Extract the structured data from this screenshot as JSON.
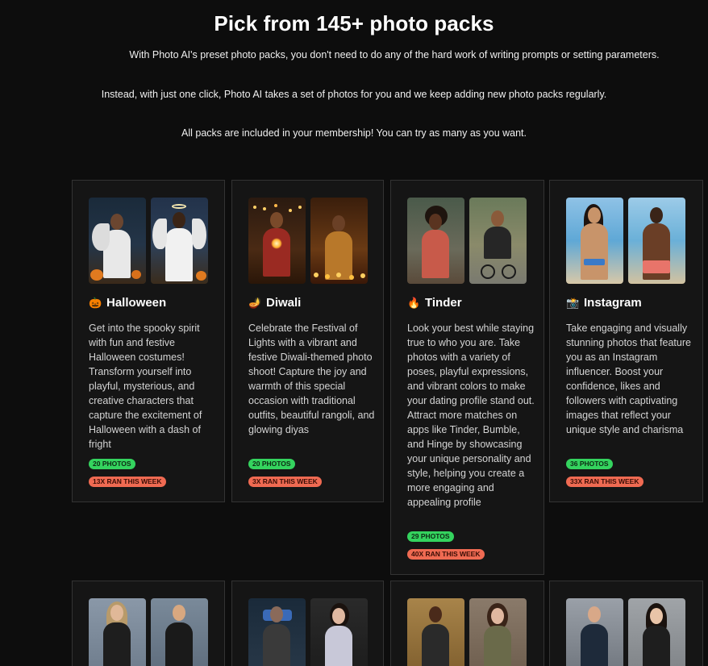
{
  "header": {
    "title": "Pick from 145+ photo packs",
    "line1": "With Photo AI's preset photo packs, you don't need to do any of the hard work of writing prompts or setting parameters.",
    "line2": "Instead, with just one click, Photo AI takes a set of photos for you and we keep adding new photo packs regularly.",
    "line3": "All packs are included in your membership! You can try as many as you want."
  },
  "packs": [
    {
      "emoji": "🎃",
      "icon": "pumpkin-icon",
      "name": "Halloween",
      "description": "Get into the spooky spirit with fun and festive Halloween costumes! Transform yourself into playful, mysterious, and creative characters that capture the excitement of Halloween with a dash of fright",
      "photos": "20 PHOTOS",
      "ran": "13X RAN THIS WEEK"
    },
    {
      "emoji": "🪔",
      "icon": "diya-lamp-icon",
      "name": "Diwali",
      "description": "Celebrate the Festival of Lights with a vibrant and festive Diwali-themed photo shoot! Capture the joy and warmth of this special occasion with traditional outfits, beautiful rangoli, and glowing diyas",
      "photos": "20 PHOTOS",
      "ran": "3X RAN THIS WEEK"
    },
    {
      "emoji": "🔥",
      "icon": "fire-icon",
      "name": "Tinder",
      "description": "Look your best while staying true to who you are. Take photos with a variety of poses, playful expressions, and vibrant colors to make your dating profile stand out. Attract more matches on apps like Tinder, Bumble, and Hinge by showcasing your unique personality and style, helping you create a more engaging and appealing profile",
      "photos": "29 PHOTOS",
      "ran": "40X RAN THIS WEEK"
    },
    {
      "emoji": "📸",
      "icon": "camera-icon",
      "name": "Instagram",
      "description": "Take engaging and visually stunning photos that feature you as an Instagram influencer. Boost your confidence, likes and followers with captivating images that reflect your unique style and charisma",
      "photos": "36 PHOTOS",
      "ran": "33X RAN THIS WEEK"
    }
  ],
  "colors": {
    "background": "#0d0d0d",
    "card": "#151515",
    "photos_badge": "#34d35e",
    "ran_badge": "#ef6a52"
  }
}
